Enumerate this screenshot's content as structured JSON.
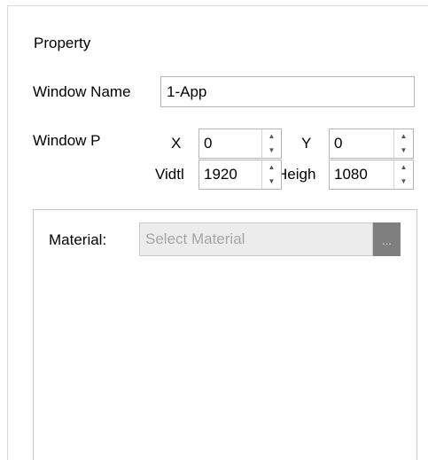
{
  "header": {
    "title": "Property"
  },
  "window_name": {
    "label": "Window Name",
    "value": "1-App"
  },
  "window_pos": {
    "label": "Window P"
  },
  "x": {
    "label": "X",
    "value": "0"
  },
  "y": {
    "label": "Y",
    "value": "0"
  },
  "width": {
    "label": "Vidtl",
    "value": "1920"
  },
  "height": {
    "label": "Heigh",
    "value": "1080"
  },
  "material": {
    "label": "Material:",
    "placeholder": "Select Material",
    "browse_label": "..."
  },
  "icons": {
    "up": "spin-up-icon",
    "down": "spin-down-icon"
  }
}
